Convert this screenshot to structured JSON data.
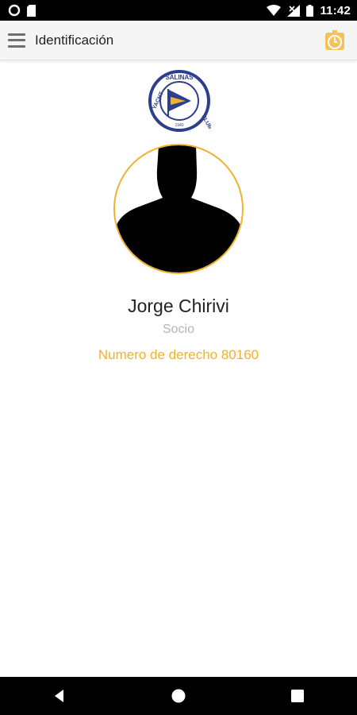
{
  "status_bar": {
    "time": "11:42",
    "icons": [
      "circle-icon",
      "sim-card-icon",
      "wifi-icon",
      "signal-off-icon",
      "battery-icon"
    ]
  },
  "app_bar": {
    "title": "Identificación",
    "menu_icon": "hamburger-menu-icon",
    "action_icon": "timer-icon",
    "accent_color": "#f0b22a"
  },
  "logo": {
    "text_top": "SALINAS",
    "text_left": "YACHT",
    "text_right": "CLUB",
    "year": "1940"
  },
  "profile": {
    "name": "Jorge Chirivi",
    "role": "Socio",
    "membership_number": "Numero de derecho 80160"
  },
  "nav_bar": {
    "icons": [
      "back-icon",
      "home-icon",
      "recents-icon"
    ]
  }
}
